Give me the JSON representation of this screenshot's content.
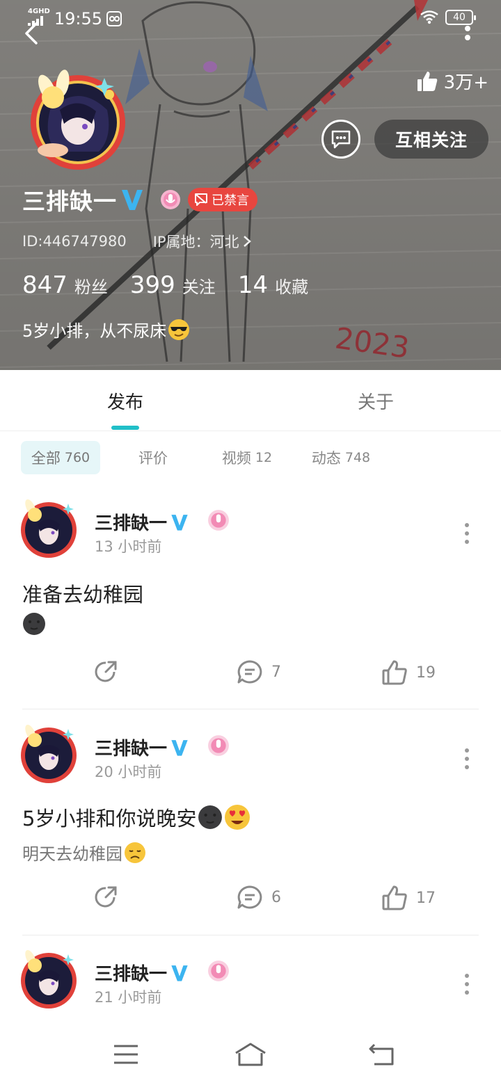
{
  "status_bar": {
    "network": "4GHD",
    "time": "19:55",
    "battery": "40"
  },
  "profile": {
    "likes_total": "3万+",
    "follow_button": "互相关注",
    "name": "三排缺一",
    "muted_badge": "已禁言",
    "id_text": "ID:446747980",
    "ip_label": "IP属地：河北",
    "stats": {
      "fans_count": "847",
      "fans_label": "粉丝",
      "following_count": "399",
      "following_label": "关注",
      "favorites_count": "14",
      "favorites_label": "收藏"
    },
    "bio": "5岁小排，从不尿床"
  },
  "tabs": {
    "publish": "发布",
    "about": "关于"
  },
  "filters": {
    "all_label": "全部",
    "all_count": "760",
    "review_label": "评价",
    "video_label": "视频",
    "video_count": "12",
    "dynamic_label": "动态",
    "dynamic_count": "748"
  },
  "posts": [
    {
      "author": "三排缺一",
      "time": "13 小时前",
      "title": "准备去幼稚园",
      "body": "",
      "comments": "7",
      "likes": "19"
    },
    {
      "author": "三排缺一",
      "time": "20 小时前",
      "title": "5岁小排和你说晚安",
      "body": "明天去幼稚园",
      "comments": "6",
      "likes": "17"
    },
    {
      "author": "三排缺一",
      "time": "21 小时前",
      "title": "",
      "body": "",
      "comments": "",
      "likes": ""
    }
  ],
  "colors": {
    "accent": "#21bfc8",
    "verified": "#3cb4f0",
    "muted_red": "#e8463f",
    "voice_pink": "#f28bb5"
  }
}
